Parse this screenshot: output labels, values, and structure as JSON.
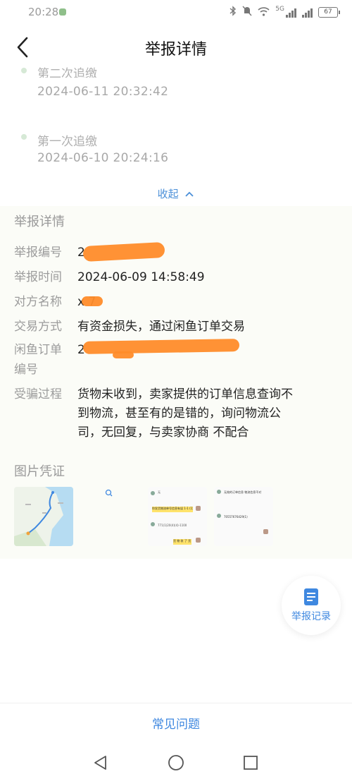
{
  "status_bar": {
    "time": "20:28",
    "battery": "67",
    "network": "5G"
  },
  "header": {
    "title": "举报详情"
  },
  "timeline": [
    {
      "title": "第二次追缴",
      "date": "2024-06-11 20:32:42"
    },
    {
      "title": "第一次追缴",
      "date": "2024-06-10 20:24:16"
    }
  ],
  "collapse_label": "收起",
  "details": {
    "section_title": "举报详情",
    "rows": [
      {
        "label": "举报编号",
        "value": "2"
      },
      {
        "label": "举报时间",
        "value": "2024-06-09 14:58:49"
      },
      {
        "label": "对方名称",
        "value": "x 7"
      },
      {
        "label": "交易方式",
        "value": "有资金损失，通过闲鱼订单交易"
      },
      {
        "label_line1": "闲鱼订单",
        "label_line2": "编号",
        "value": "2"
      },
      {
        "label": "受骗过程",
        "value_lines": [
          "货物未收到，卖家提供的订单信息查询不",
          "到物流，甚至有的是错的，询问物流公",
          "司，无回复，与卖家协商 不配合"
        ]
      }
    ],
    "evidence_title": "图片凭证"
  },
  "thumbnails": {
    "chat2": {
      "line1": "无",
      "bubble1": "你发货物流单号信息有误 1-1 (1)",
      "line2": "771(1)20(4)(4)-1100",
      "bubble2": "货 物 收 了 货 呢 ?"
    },
    "chat3": {
      "line1": "无效的订单信息 物流信息不对",
      "line2": "70557676429(1)"
    }
  },
  "floating_button": {
    "label": "举报记录"
  },
  "bottom": {
    "faq_label": "常见问题"
  },
  "colors": {
    "accent": "#3f88e0",
    "redaction": "#ff8c2a"
  }
}
